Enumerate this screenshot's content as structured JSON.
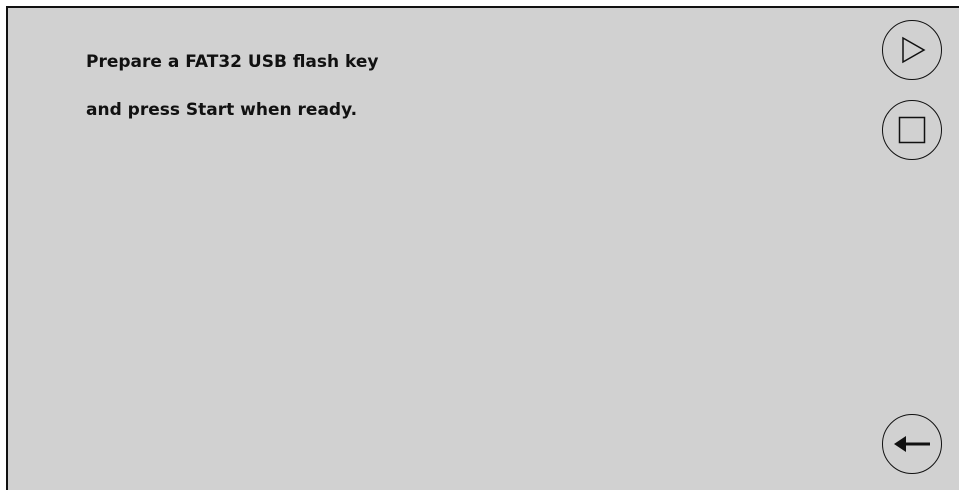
{
  "message": {
    "line1": "Prepare a FAT32 USB flash key",
    "line2": "and press Start when ready."
  },
  "buttons": {
    "start_icon": "play-icon",
    "stop_icon": "stop-icon",
    "back_icon": "arrow-left-icon"
  },
  "colors": {
    "background": "#d1d1d1",
    "foreground": "#111111"
  }
}
